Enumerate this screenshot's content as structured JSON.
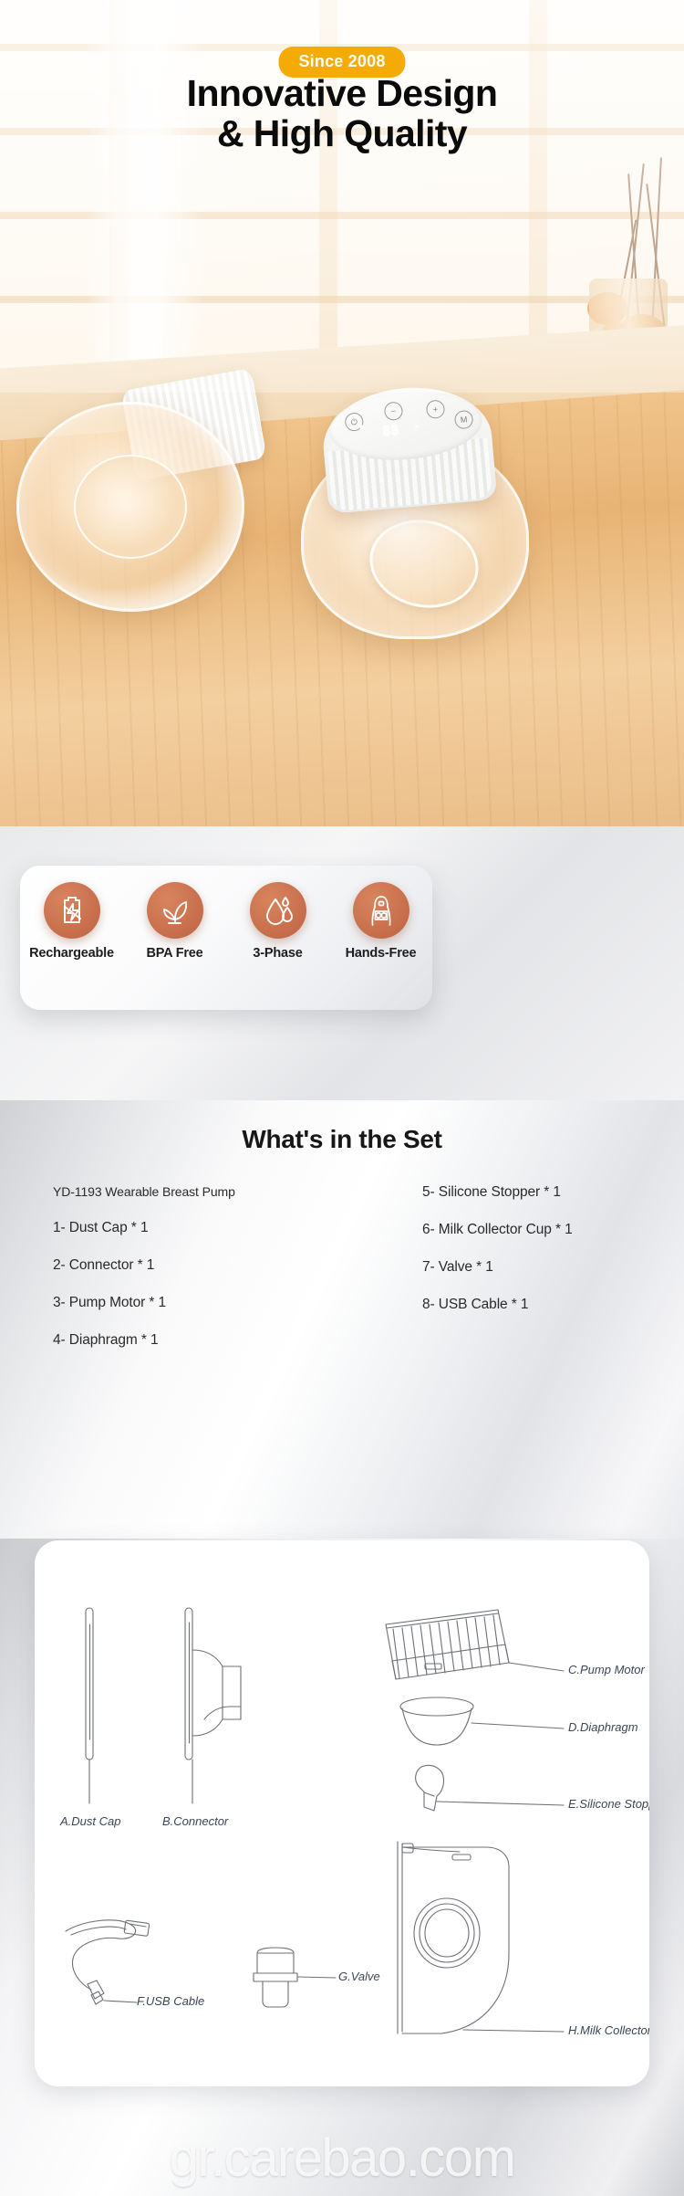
{
  "hero": {
    "badge": "Since 2008",
    "title_line1": "Innovative Design",
    "title_line2": "& High Quality",
    "badge_color": "#f5ab06",
    "device_buttons": [
      "power-icon",
      "minus-icon",
      "plus-icon",
      "M"
    ],
    "device_display": "88"
  },
  "features": {
    "items": [
      {
        "label": "Rechargeable",
        "icon": "battery-charging-icon"
      },
      {
        "label": "BPA Free",
        "icon": "leaf-plant-icon"
      },
      {
        "label": "3-Phase",
        "icon": "water-drops-icon"
      },
      {
        "label": "Hands-Free",
        "icon": "mother-wearing-pump-icon"
      }
    ],
    "accent_color": "#cb7350"
  },
  "set": {
    "title": "What's in the Set",
    "left_items": [
      "YD-1193 Wearable Breast Pump",
      "1- Dust Cap * 1",
      "2- Connector * 1",
      "3- Pump Motor * 1",
      "4- Diaphragm * 1"
    ],
    "right_items": [
      "5- Silicone Stopper * 1",
      "6- Milk Collector Cup * 1",
      "7- Valve * 1",
      "8- USB Cable * 1"
    ]
  },
  "parts": {
    "labels": [
      {
        "text": "A.Dust Cap"
      },
      {
        "text": "B.Connector"
      },
      {
        "text": "C.Pump Motor"
      },
      {
        "text": "D.Diaphragm"
      },
      {
        "text": "E.Silicone Stopper"
      },
      {
        "text": "F.USB Cable"
      },
      {
        "text": "G.Valve"
      },
      {
        "text": "H.Milk Collector Cup"
      }
    ]
  },
  "watermark": "gr.carebao.com"
}
